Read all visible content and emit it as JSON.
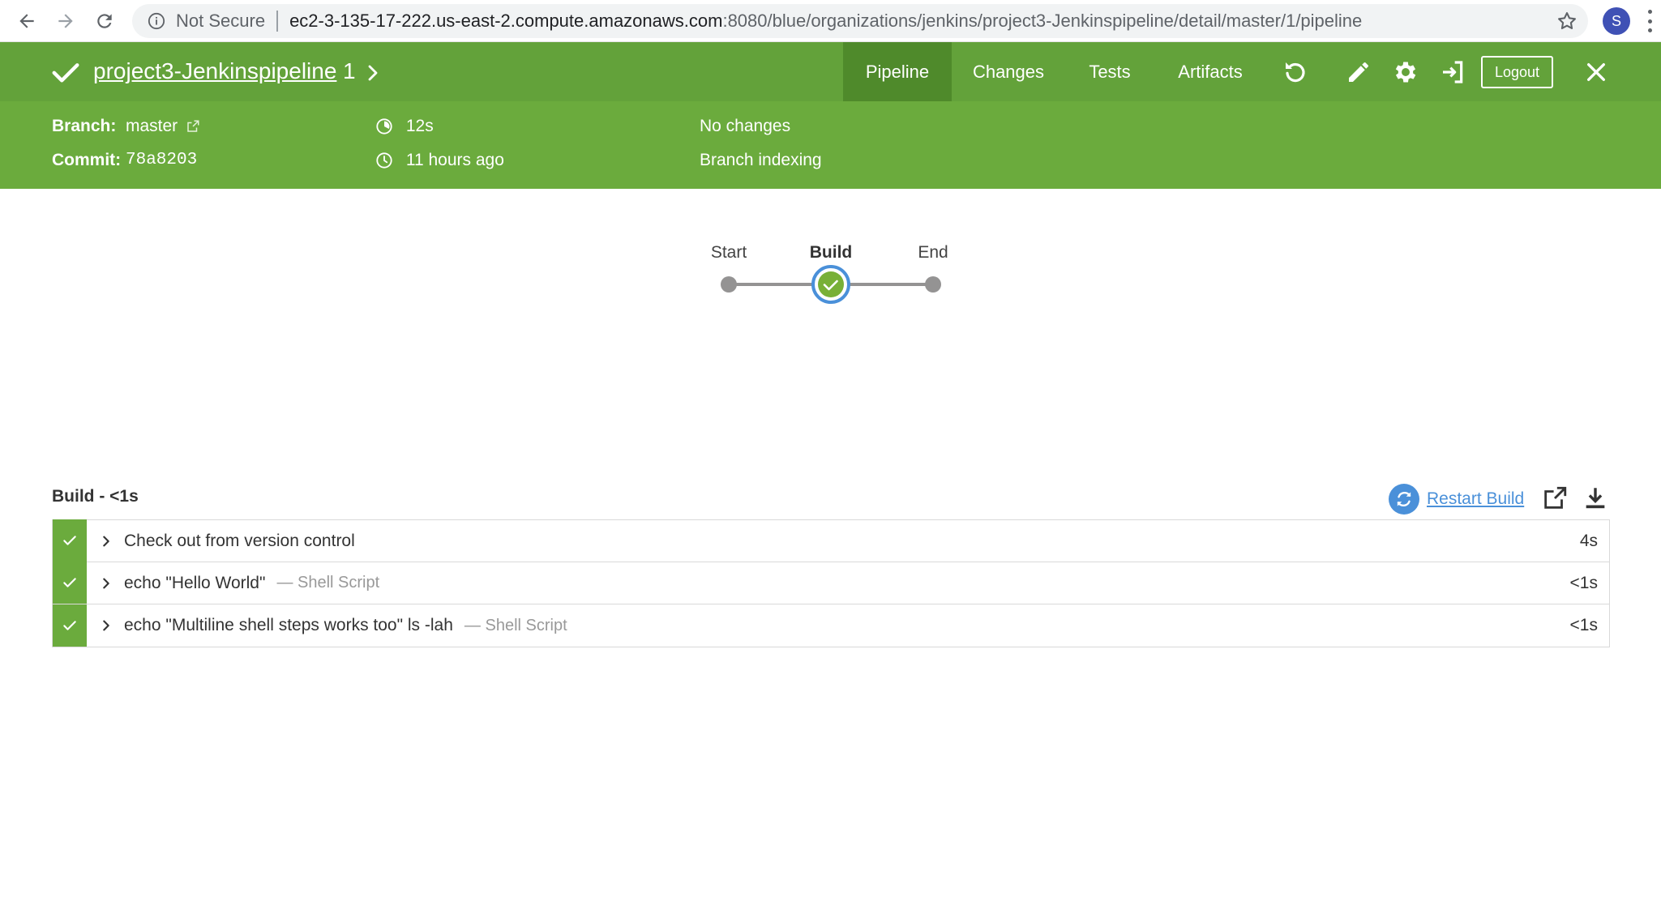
{
  "browser": {
    "security_label": "Not Secure",
    "url_host": "ec2-3-135-17-222.us-east-2.compute.amazonaws.com",
    "url_path": ":8080/blue/organizations/jenkins/project3-Jenkinspipeline/detail/master/1/pipeline",
    "profile_initial": "S"
  },
  "header": {
    "pipeline_name": "project3-Jenkinspipeline",
    "run_number": "1",
    "status": "success",
    "tabs": [
      {
        "label": "Pipeline",
        "active": true
      },
      {
        "label": "Changes",
        "active": false
      },
      {
        "label": "Tests",
        "active": false
      },
      {
        "label": "Artifacts",
        "active": false
      }
    ],
    "logout_label": "Logout",
    "icons": [
      "rerun-icon",
      "edit-icon",
      "settings-icon",
      "go-to-classic-icon",
      "close-icon"
    ]
  },
  "details": {
    "branch_label": "Branch:",
    "branch_value": "master",
    "commit_label": "Commit:",
    "commit_value": "78a8203",
    "duration": "12s",
    "time_ago": "11 hours ago",
    "changes": "No changes",
    "cause": "Branch indexing"
  },
  "graph": {
    "stages": [
      {
        "label": "Start",
        "selected": false
      },
      {
        "label": "Build",
        "selected": true,
        "status": "success"
      },
      {
        "label": "End",
        "selected": false
      }
    ]
  },
  "steps_panel": {
    "title": "Build - <1s",
    "restart_label": "Restart Build",
    "steps": [
      {
        "title": "Check out from version control",
        "type": "",
        "duration": "4s"
      },
      {
        "title": "echo \"Hello World\"",
        "type": "— Shell Script",
        "duration": "<1s"
      },
      {
        "title": "echo \"Multiline shell steps works too\" ls -lah",
        "type": "— Shell Script",
        "duration": "<1s"
      }
    ]
  },
  "colors": {
    "topbar": "#63a23a",
    "details_bar": "#6bab3d",
    "active_tab": "#4f8a2b",
    "success": "#6bab3d",
    "link": "#4a90d9"
  }
}
